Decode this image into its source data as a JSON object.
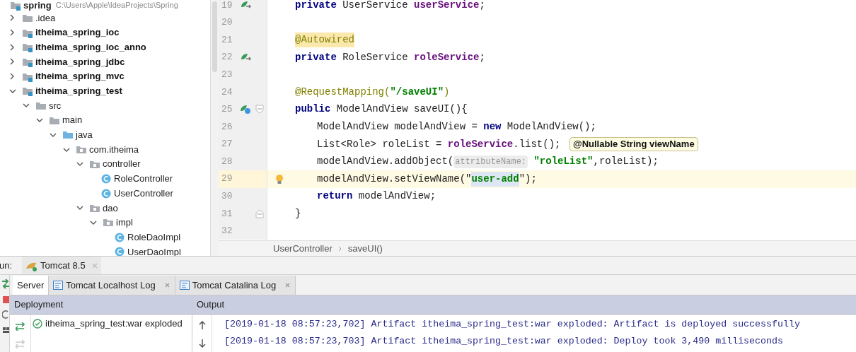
{
  "project_tree": {
    "root": {
      "name": "spring",
      "path": "C:\\Users\\Apple\\IdeaProjects\\Spring"
    },
    "items": [
      {
        "name": ".idea",
        "kind": "folder",
        "expanded": false
      },
      {
        "name": "itheima_spring_ioc",
        "kind": "module",
        "expanded": false
      },
      {
        "name": "itheima_spring_ioc_anno",
        "kind": "module",
        "expanded": false
      },
      {
        "name": "itheima_spring_jdbc",
        "kind": "module",
        "expanded": false
      },
      {
        "name": "itheima_spring_mvc",
        "kind": "module",
        "expanded": false
      },
      {
        "name": "itheima_spring_test",
        "kind": "module",
        "expanded": true,
        "children": [
          {
            "name": "src",
            "kind": "folder",
            "expanded": true,
            "children": [
              {
                "name": "main",
                "kind": "folder",
                "expanded": true,
                "children": [
                  {
                    "name": "java",
                    "kind": "source_root",
                    "expanded": true,
                    "children": [
                      {
                        "name": "com.itheima",
                        "kind": "package",
                        "expanded": true,
                        "children": [
                          {
                            "name": "controller",
                            "kind": "package",
                            "expanded": true,
                            "children": [
                              {
                                "name": "RoleController",
                                "kind": "class"
                              },
                              {
                                "name": "UserController",
                                "kind": "class"
                              }
                            ]
                          },
                          {
                            "name": "dao",
                            "kind": "package",
                            "expanded": true,
                            "children": [
                              {
                                "name": "impl",
                                "kind": "package",
                                "expanded": true,
                                "children": [
                                  {
                                    "name": "RoleDaoImpl",
                                    "kind": "class"
                                  },
                                  {
                                    "name": "UserDaoImpl",
                                    "kind": "class"
                                  }
                                ]
                              }
                            ]
                          }
                        ]
                      }
                    ]
                  }
                ]
              }
            ]
          }
        ]
      }
    ]
  },
  "editor": {
    "lines": [
      {
        "number": "19",
        "gutter_icon": {
          "kind": "bean_injected"
        },
        "tokens": [
          {
            "text": "private",
            "kind": "keyword"
          },
          {
            "text": " UserService ",
            "kind": "plain"
          },
          {
            "text": "userService",
            "kind": "field"
          },
          {
            "text": ";",
            "kind": "plain"
          }
        ]
      },
      {
        "number": "20"
      },
      {
        "number": "21",
        "tokens": [
          {
            "text": "@Autowired",
            "kind": "annotation_marked"
          }
        ]
      },
      {
        "number": "22",
        "gutter_icon": {
          "kind": "bean_injected"
        },
        "tokens": [
          {
            "text": "private",
            "kind": "keyword"
          },
          {
            "text": " RoleService ",
            "kind": "plain"
          },
          {
            "text": "roleService",
            "kind": "field"
          },
          {
            "text": ";",
            "kind": "plain"
          }
        ]
      },
      {
        "number": "23"
      },
      {
        "number": "24",
        "tokens": [
          {
            "text": "@RequestMapping(",
            "kind": "annotation"
          },
          {
            "text": "\"/saveUI\"",
            "kind": "string"
          },
          {
            "text": ")",
            "kind": "annotation"
          }
        ]
      },
      {
        "number": "25",
        "gutter_icon": {
          "kind": "bean_mapping"
        },
        "fold": {
          "kind": "start"
        },
        "tokens": [
          {
            "text": "public",
            "kind": "keyword"
          },
          {
            "text": " ModelAndView saveUI(){",
            "kind": "plain"
          }
        ],
        "children": [
          {
            "number": "26",
            "tokens": [
              {
                "text": "ModelAndView modelAndView = ",
                "kind": "plain"
              },
              {
                "text": "new",
                "kind": "keyword"
              },
              {
                "text": " ModelAndView();",
                "kind": "plain"
              }
            ]
          },
          {
            "number": "27",
            "tokens": [
              {
                "text": "List<Role> roleList = ",
                "kind": "plain"
              },
              {
                "text": "roleService",
                "kind": "field"
              },
              {
                "text": ".list();",
                "kind": "plain"
              }
            ]
          },
          {
            "number": "28",
            "tokens": [
              {
                "text": "modelAndView.addObject(",
                "kind": "plain"
              },
              {
                "text": "attributeName:",
                "kind": "hint"
              },
              {
                "text": " \"roleList\"",
                "kind": "string"
              },
              {
                "text": ",roleList);",
                "kind": "plain"
              }
            ]
          },
          {
            "number": "29",
            "current": true,
            "bulb": true,
            "tokens": [
              {
                "text": "modelAndView.setViewName(\"",
                "kind": "mixed_open"
              },
              {
                "text": "user-add",
                "kind": "string_selected"
              },
              {
                "text": "\");",
                "kind": "mixed_close"
              }
            ]
          },
          {
            "number": "30",
            "tokens": [
              {
                "text": "return",
                "kind": "keyword"
              },
              {
                "text": " modelAndView;",
                "kind": "plain"
              }
            ]
          }
        ]
      },
      {
        "number": "31",
        "fold": {
          "kind": "end"
        },
        "tokens": [
          {
            "text": "}",
            "kind": "plain"
          }
        ]
      },
      {
        "number": "32"
      }
    ],
    "tooltip": {
      "text": "@Nullable String viewName"
    },
    "breadcrumb": [
      "UserController",
      "saveUI()"
    ]
  },
  "run_panel": {
    "label": "un:",
    "run_tab": {
      "title": "Tomcat 8.5"
    },
    "tabs": [
      {
        "label": "Server",
        "selected": true,
        "closable": false
      },
      {
        "label": "Tomcat Localhost Log",
        "selected": false,
        "closable": true
      },
      {
        "label": "Tomcat Catalina Log",
        "selected": false,
        "closable": true
      }
    ],
    "deployment": {
      "header": "Deployment",
      "items": [
        {
          "name": "itheima_spring_test:war exploded",
          "deployed": true
        }
      ]
    },
    "output": {
      "header": "Output",
      "lines": [
        "[2019-01-18 08:57:23,702] Artifact itheima_spring_test:war exploded: Artifact is deployed successfully",
        "[2019-01-18 08:57:23,703] Artifact itheima_spring_test:war exploded: Deploy took 3,490 milliseconds"
      ]
    }
  }
}
